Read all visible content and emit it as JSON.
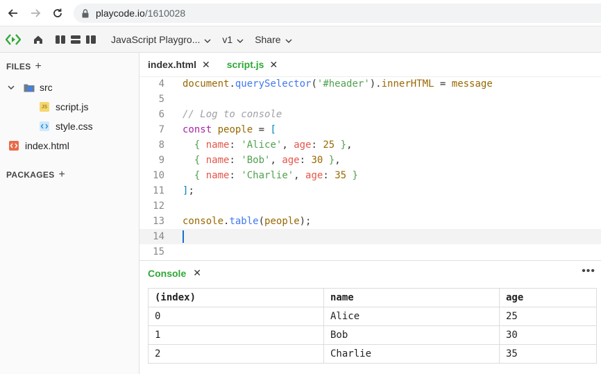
{
  "browser": {
    "url_host": "playcode.io",
    "url_path": "/1610028"
  },
  "toolbar": {
    "project_title": "JavaScript Playgro...",
    "version_label": "v1",
    "share_label": "Share"
  },
  "sidebar": {
    "files_header": "FILES",
    "packages_header": "PACKAGES",
    "folder_src": "src",
    "files": [
      "script.js",
      "style.css",
      "index.html"
    ]
  },
  "tabs": [
    {
      "label": "index.html",
      "active": false
    },
    {
      "label": "script.js",
      "active": true
    }
  ],
  "editor": {
    "lines": [
      {
        "n": "4",
        "text": "document.querySelector('#header').innerHTML = message"
      },
      {
        "n": "5",
        "text": ""
      },
      {
        "n": "6",
        "text": "// Log to console"
      },
      {
        "n": "7",
        "text": "const people = ["
      },
      {
        "n": "8",
        "text": "  { name: 'Alice', age: 25 },"
      },
      {
        "n": "9",
        "text": "  { name: 'Bob', age: 30 },"
      },
      {
        "n": "10",
        "text": "  { name: 'Charlie', age: 35 }"
      },
      {
        "n": "11",
        "text": "];"
      },
      {
        "n": "12",
        "text": ""
      },
      {
        "n": "13",
        "text": "console.table(people);"
      },
      {
        "n": "14",
        "text": ""
      },
      {
        "n": "15",
        "text": ""
      }
    ]
  },
  "console": {
    "title": "Console",
    "headers": [
      "(index)",
      "name",
      "age"
    ],
    "rows": [
      [
        "0",
        "Alice",
        "25"
      ],
      [
        "1",
        "Bob",
        "30"
      ],
      [
        "2",
        "Charlie",
        "35"
      ]
    ]
  },
  "colors": {
    "accent": "#2da836",
    "cursor": "#1a6dd6"
  }
}
